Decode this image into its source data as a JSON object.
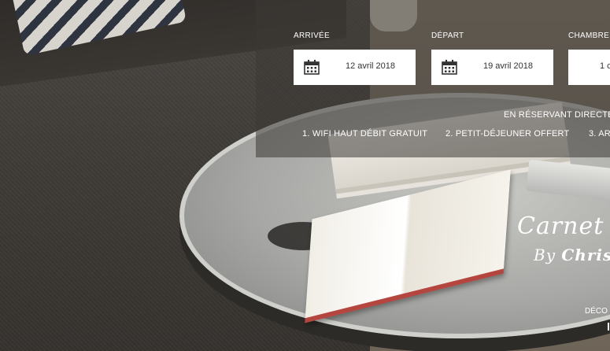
{
  "booking": {
    "arrival_label": "ARRIVÉE",
    "arrival_date": "12 avril 2018",
    "departure_label": "DÉPART",
    "departure_date": "19 avril 2018",
    "rooms_label": "CHAMBRE",
    "rooms_value": "1 c"
  },
  "promo": {
    "title": "EN RÉSERVANT DIRECTE",
    "items": [
      "1. WIFI HAUT DÉBIT GRATUIT",
      "2. PETIT-DÉJEUNER OFFERT",
      "3. AR"
    ]
  },
  "feature": {
    "title": "Carnet d",
    "by": "By",
    "author": "Christi",
    "cta": "DÉCO"
  },
  "icons": {
    "calendar": "calendar-icon"
  },
  "colors": {
    "panel": "#3c3834",
    "field_bg": "#ffffff",
    "text_dark": "#333333",
    "text_light": "#ffffff"
  }
}
